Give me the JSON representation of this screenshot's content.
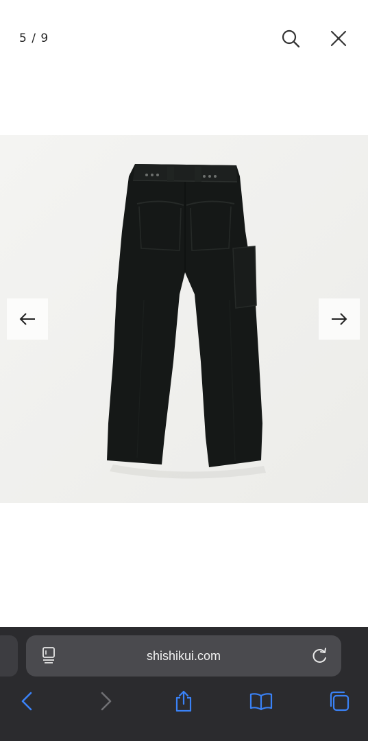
{
  "gallery": {
    "counter": "5 / 9"
  },
  "browser": {
    "url": "shishikui.com"
  },
  "colors": {
    "accent": "#3a82f7",
    "toolbar_bg": "#2b2b2e",
    "urlbar_bg": "#4a4a4e",
    "photo_bg": "#f1f1ef",
    "garment": "#151817"
  },
  "icons": [
    "search-icon",
    "close-icon",
    "arrow-left-icon",
    "arrow-right-icon",
    "page-menu-icon",
    "reload-icon",
    "back-icon",
    "forward-icon",
    "share-icon",
    "bookmarks-icon",
    "tabs-icon"
  ]
}
